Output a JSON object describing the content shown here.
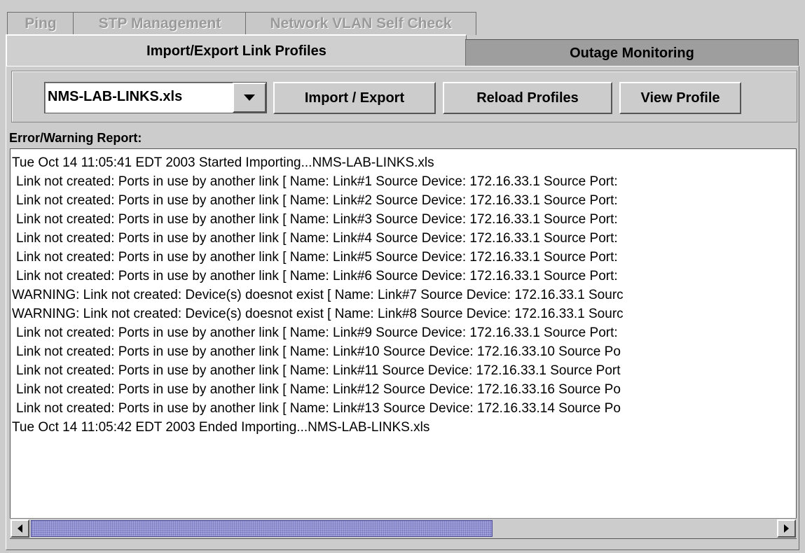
{
  "tabs": {
    "row1": [
      "Ping",
      "STP Management",
      "Network VLAN Self Check"
    ],
    "row2": [
      "Import/Export Link Profiles",
      "Outage Monitoring"
    ],
    "active": "Import/Export Link Profiles"
  },
  "toolbar": {
    "profile_select_value": "NMS-LAB-LINKS.xls",
    "import_export_label": "Import / Export",
    "reload_label": "Reload Profiles",
    "view_label": "View Profile"
  },
  "report": {
    "label": "Error/Warning Report:",
    "lines": [
      "Tue Oct 14 11:05:41 EDT 2003 Started Importing...NMS-LAB-LINKS.xls",
      " Link not created: Ports in use by another link [ Name: Link#1 Source Device: 172.16.33.1 Source Port:",
      " Link not created: Ports in use by another link [ Name: Link#2 Source Device: 172.16.33.1 Source Port:",
      " Link not created: Ports in use by another link [ Name: Link#3 Source Device: 172.16.33.1 Source Port:",
      " Link not created: Ports in use by another link [ Name: Link#4 Source Device: 172.16.33.1 Source Port:",
      " Link not created: Ports in use by another link [ Name: Link#5 Source Device: 172.16.33.1 Source Port:",
      " Link not created: Ports in use by another link [ Name: Link#6 Source Device: 172.16.33.1 Source Port:",
      "WARNING: Link not created: Device(s) doesnot exist [ Name: Link#7 Source Device: 172.16.33.1 Sourc",
      "WARNING: Link not created: Device(s) doesnot exist [ Name: Link#8 Source Device: 172.16.33.1 Sourc",
      " Link not created: Ports in use by another link [ Name: Link#9 Source Device: 172.16.33.1 Source Port:",
      " Link not created: Ports in use by another link [ Name: Link#10 Source Device: 172.16.33.10 Source Po",
      " Link not created: Ports in use by another link [ Name: Link#11 Source Device: 172.16.33.1 Source Port",
      " Link not created: Ports in use by another link [ Name: Link#12 Source Device: 172.16.33.16 Source Po",
      " Link not created: Ports in use by another link [ Name: Link#13 Source Device: 172.16.33.14 Source Po",
      "Tue Oct 14 11:05:42 EDT 2003 Ended Importing...NMS-LAB-LINKS.xls"
    ]
  },
  "scrollbar": {
    "horizontal_position_fraction": 0.0,
    "visible_fraction": 0.62
  },
  "colors": {
    "background": "#cccccc",
    "scroll_thumb": "#a9a9e0",
    "inactive_tab_text": "#9a9a9a"
  }
}
